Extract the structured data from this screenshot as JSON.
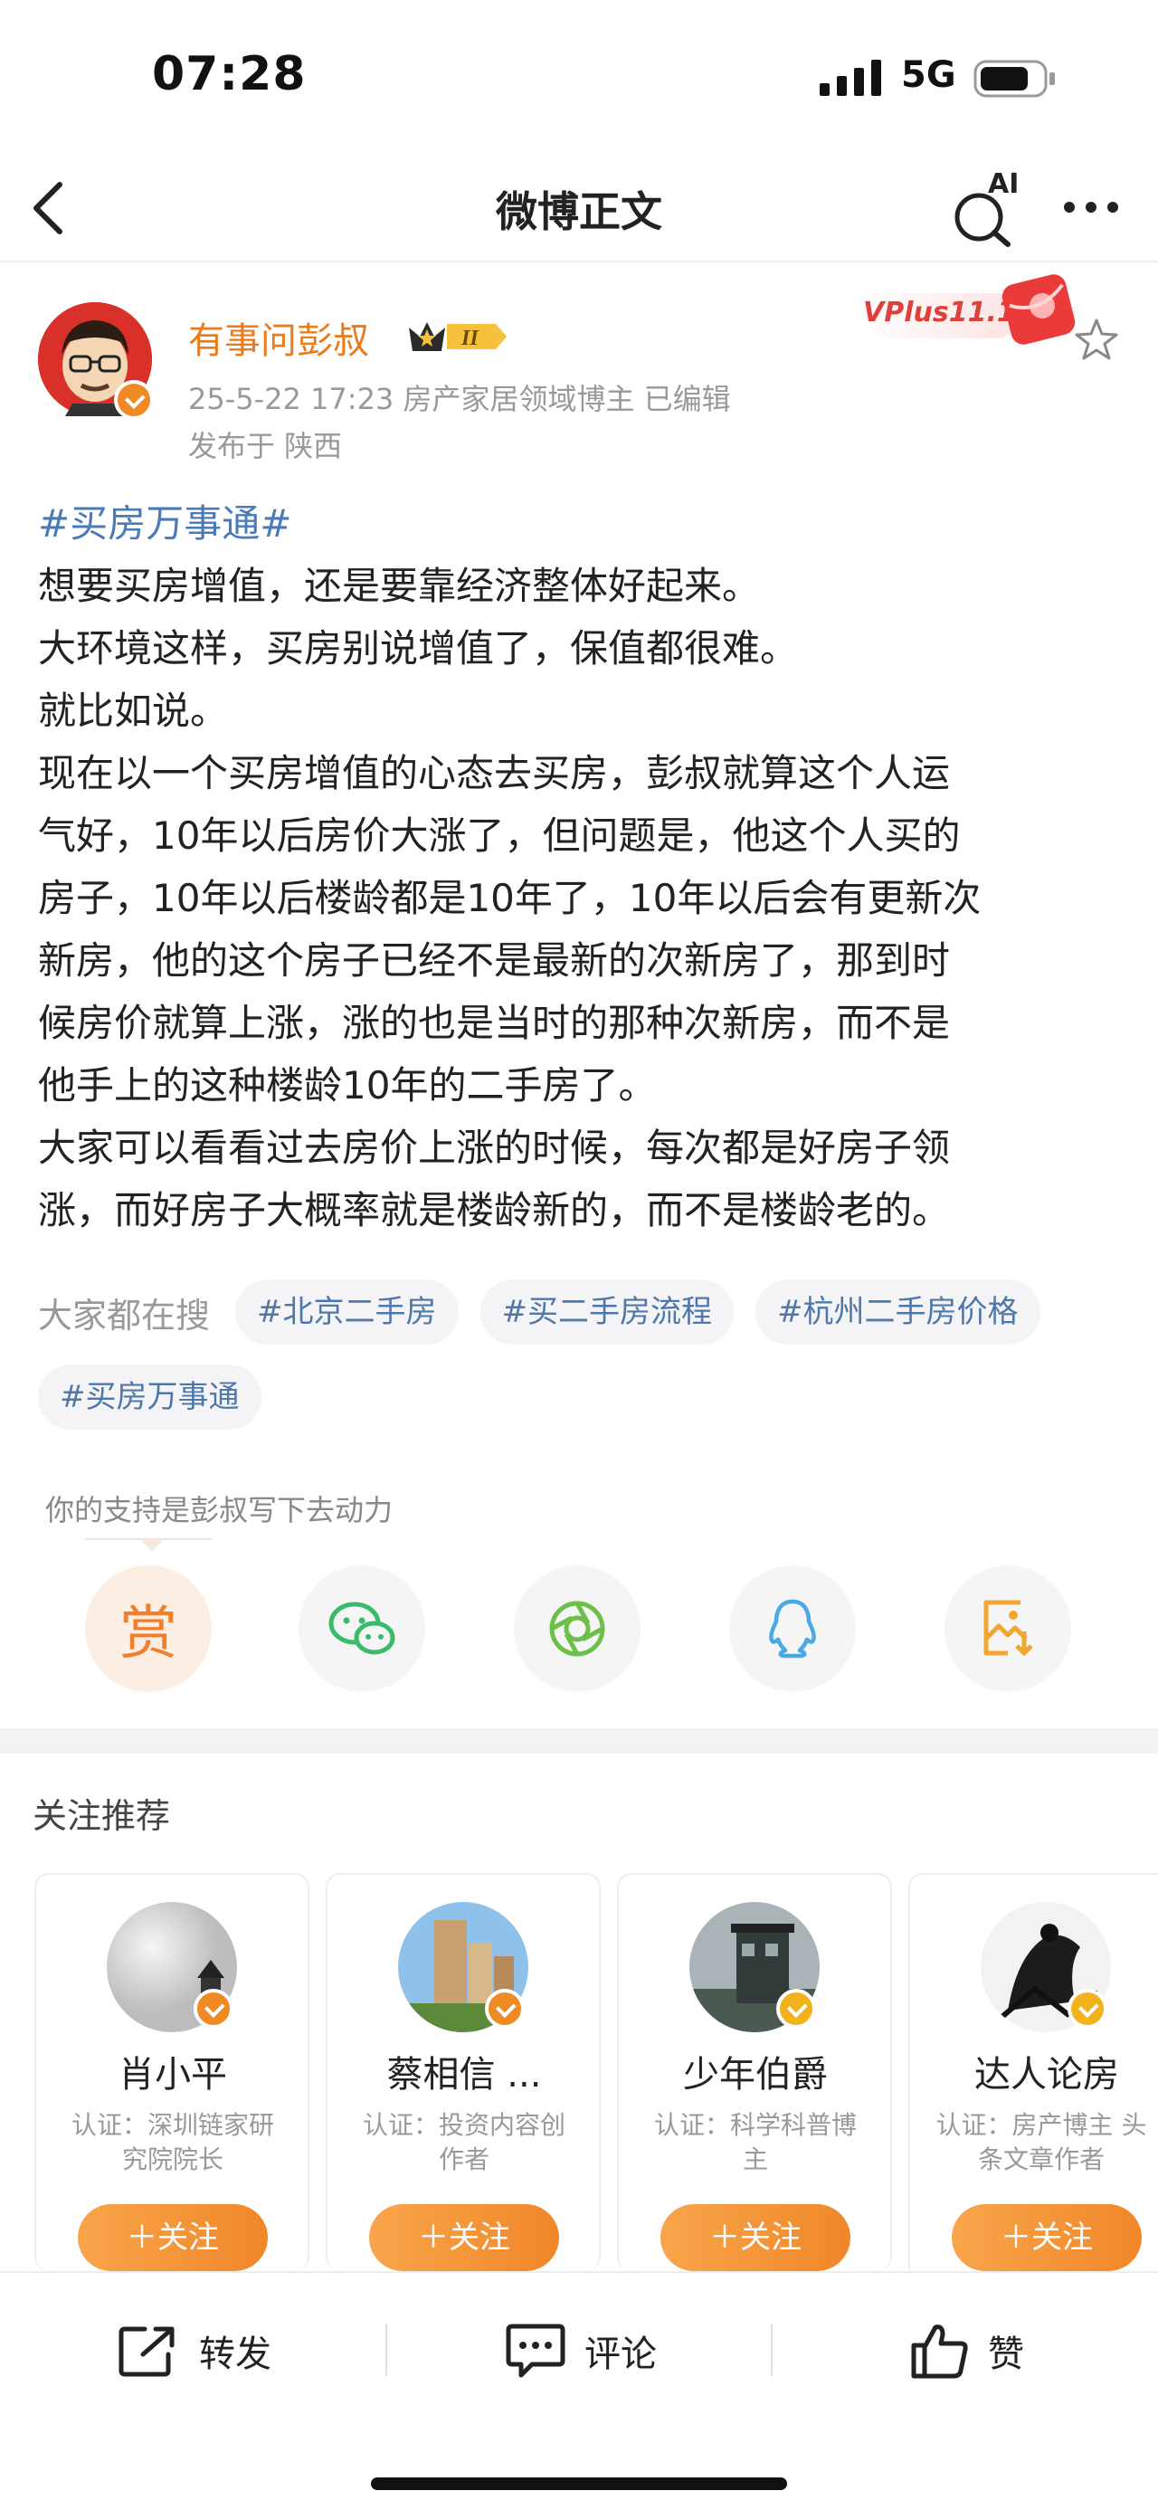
{
  "status": {
    "time": "07:28",
    "network": "5G"
  },
  "nav": {
    "title": "微博正文",
    "ai_label": "AI"
  },
  "author": {
    "name": "有事问彭叔",
    "level_label": "II",
    "meta": "25-5-22 17:23  房产家居领域博主  已编辑",
    "location": "发布于 陕西",
    "vplus_label": "VPlus11.11"
  },
  "post": {
    "tag": "#买房万事通#",
    "lines": [
      "想要买房增值，还是要靠经济整体好起来。",
      "大环境这样，买房别说增值了，保值都很难。",
      "就比如说。",
      "现在以一个买房增值的心态去买房，彭叔就算这个人运",
      "气好，10年以后房价大涨了，但问题是，他这个人买的",
      "房子，10年以后楼龄都是10年了，10年以后会有更新次",
      "新房，他的这个房子已经不是最新的次新房了，那到时",
      "候房价就算上涨，涨的也是当时的那种次新房，而不是",
      "他手上的这种楼龄10年的二手房了。",
      "大家可以看看过去房价上涨的时候，每次都是好房子领",
      "涨，而好房子大概率就是楼龄新的，而不是楼龄老的。"
    ]
  },
  "search": {
    "label": "大家都在搜",
    "chips": [
      "#北京二手房",
      "#买二手房流程",
      "#杭州二手房价格",
      "#买房万事通"
    ]
  },
  "support": {
    "label": "你的支持是彭叔写下去动力",
    "reward_glyph": "赏"
  },
  "recommend": {
    "title": "关注推荐",
    "follow_label": "＋关注",
    "cards": [
      {
        "name": "肖小平",
        "cert_line1": "认证：深圳链家研",
        "cert_line2": "究院院长"
      },
      {
        "name": "蔡相信 ...",
        "cert_line1": "认证：投资内容创",
        "cert_line2": "作者"
      },
      {
        "name": "少年伯爵",
        "cert_line1": "认证：科学科普博",
        "cert_line2": "主"
      },
      {
        "name": "达人论房",
        "cert_line1": "认证：房产博主 头",
        "cert_line2": "条文章作者"
      }
    ]
  },
  "bottom": {
    "repost": "转发",
    "comment": "评论",
    "like": "赞"
  },
  "colors": {
    "accent": "#eb7a1b",
    "link": "#4a7ab8",
    "follow": "#f08729"
  }
}
